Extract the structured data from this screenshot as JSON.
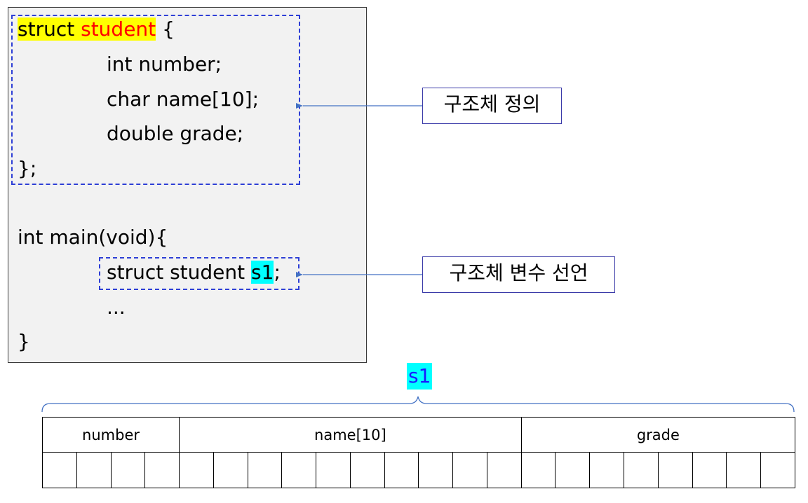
{
  "code": {
    "struct_keyword": "struct",
    "struct_name": "student",
    "open_brace": "{",
    "field_number": "int number;",
    "field_name": "char name[10];",
    "field_grade": "double grade;",
    "struct_close": "};",
    "main_sig": "int main(void){",
    "decl_prefix": "struct student ",
    "decl_var": "s1",
    "decl_suffix": ";",
    "ellipsis": "...",
    "main_close": "}"
  },
  "annotations": {
    "definition_label": "구조체 정의",
    "declaration_label": "구조체 변수 선언"
  },
  "memory": {
    "var_label": "s1",
    "fields": [
      {
        "name": "number",
        "bytes": 4
      },
      {
        "name": "name[10]",
        "bytes": 10
      },
      {
        "name": "grade",
        "bytes": 8
      }
    ]
  },
  "colors": {
    "highlight_yellow": "#ffff00",
    "highlight_cyan": "#00ffff",
    "keyword_red": "#ff0000",
    "arrow_blue": "#4472c4",
    "dash_blue": "#2e3fd6"
  }
}
